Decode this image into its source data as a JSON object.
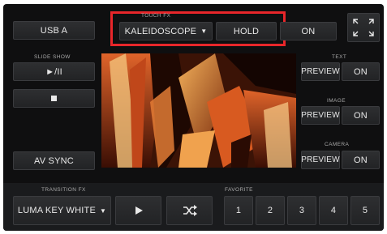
{
  "source": {
    "label": "USB A"
  },
  "touch_fx": {
    "title": "TOUCH FX",
    "effect": "KALEIDOSCOPE",
    "hold_label": "HOLD",
    "on_label": "ON"
  },
  "slideshow": {
    "title": "SLIDE SHOW",
    "play_pause_label": "►/II"
  },
  "av_sync": {
    "label": "AV SYNC"
  },
  "text_layer": {
    "title": "TEXT",
    "preview_label": "PREVIEW",
    "on_label": "ON"
  },
  "image_layer": {
    "title": "IMAGE",
    "preview_label": "PREVIEW",
    "on_label": "ON"
  },
  "camera_layer": {
    "title": "CAMERA",
    "preview_label": "PREVIEW",
    "on_label": "ON"
  },
  "transition_fx": {
    "title": "TRANSITION FX",
    "effect": "LUMA KEY WHITE"
  },
  "favorite": {
    "title": "FAVORITE",
    "slots": [
      "1",
      "2",
      "3",
      "4",
      "5"
    ]
  },
  "colors": {
    "highlight": "#e8262a",
    "panel": "#0f0f10"
  }
}
